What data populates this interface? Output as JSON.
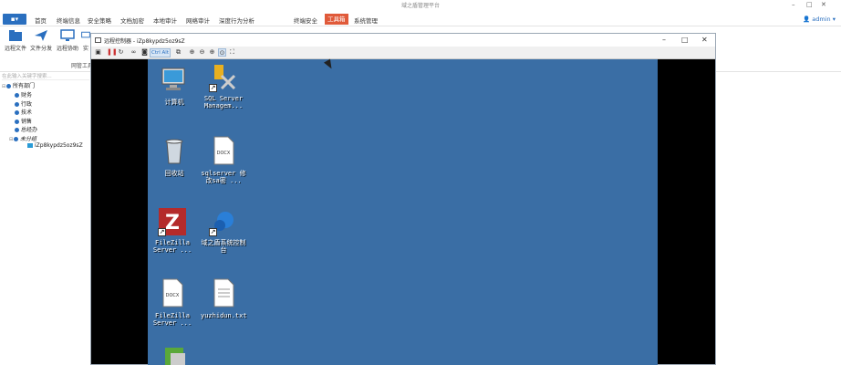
{
  "app": {
    "title": "域之盾管理平台",
    "menu_button": "▪▾",
    "admin": "admin"
  },
  "menu": [
    "首页",
    "终端信息",
    "安全策略",
    "文档加密",
    "本地审计",
    "网络审计",
    "深度行为分析",
    "终端安全",
    "工具箱",
    "系统管理"
  ],
  "toolbar": {
    "items": [
      "远程文件",
      "文件分发",
      "远程协助",
      "实"
    ],
    "group_label": "网管工具"
  },
  "sidebar": {
    "search_placeholder": "在此输入关键字搜索...",
    "tree": {
      "root": "所有部门",
      "departments": [
        "财务",
        "行政",
        "技术",
        "销售",
        "总经办",
        "未分组"
      ],
      "device": "iZp8kypdz5oz9sZ"
    }
  },
  "remote": {
    "title": "远程控制器 - iZp8kypdz5oz9sZ",
    "ctrl_badge": "Ctrl Alt",
    "icons": [
      {
        "label": "计算机",
        "type": "computer"
      },
      {
        "label": "SQL Server Managem...",
        "type": "sql"
      },
      {
        "label": "回收站",
        "type": "recycle"
      },
      {
        "label": "sqlserver 修改sa密 ...",
        "type": "docx"
      },
      {
        "label": "FileZilla Server ...",
        "type": "filezilla"
      },
      {
        "label": "域之盾系统控制台",
        "type": "domain"
      },
      {
        "label": "FileZilla Server ...",
        "type": "docx"
      },
      {
        "label": "yuzhidun.txt",
        "type": "txt"
      },
      {
        "label": "",
        "type": "app"
      }
    ]
  }
}
